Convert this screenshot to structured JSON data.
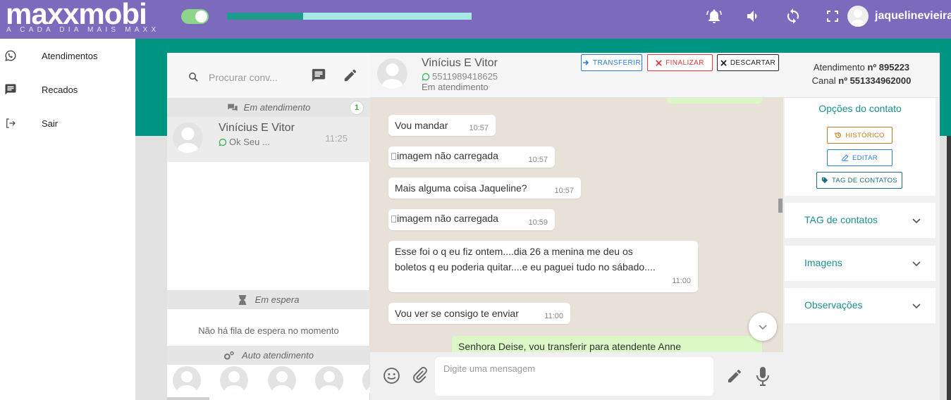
{
  "brand": {
    "name": "maxxmobi",
    "tagline": "A CADA DIA MAIS MAXX"
  },
  "topbar": {
    "progress_fraction": 0.31,
    "username": "jaquelinevieira",
    "icons": [
      "bell-icon",
      "volume-icon",
      "sync-icon",
      "fullscreen-icon"
    ]
  },
  "sidebar": {
    "items": [
      {
        "label": "Atendimentos",
        "icon": "whatsapp-icon"
      },
      {
        "label": "Recados",
        "icon": "message-icon"
      },
      {
        "label": "Sair",
        "icon": "logout-icon"
      }
    ]
  },
  "left": {
    "search_placeholder": "Procurar conv...",
    "section_active": "Em atendimento",
    "active_count": "1",
    "contact": {
      "name": "Vinícius E Vitor",
      "preview": "Ok  Seu ...",
      "time": "11:25"
    },
    "section_waiting": "Em espera",
    "waiting_empty": "Não há fila de espera no momento",
    "section_auto": "Auto atendimento"
  },
  "chat": {
    "name": "Vinícius E Vitor",
    "phone": "5511989418625",
    "status": "Em atendimento",
    "buttons": {
      "transfer": "TRANSFERIR",
      "finish": "FINALIZAR",
      "discard": "DESCARTAR"
    },
    "messages": [
      {
        "text": "Vou mandar",
        "time": "10:57"
      },
      {
        "text": "imagem não carregada",
        "time": "10:57",
        "image": true
      },
      {
        "text": "Mais alguma coisa Jaqueline?",
        "time": "10:57"
      },
      {
        "text": "imagem não carregada",
        "time": "10:59",
        "image": true
      },
      {
        "text": "Esse foi o q eu fiz ontem....dia 26 a menina me deu os boletos q eu poderia quitar....e eu paguei tudo  no sábado....",
        "time": "11:00"
      },
      {
        "text": "Vou ver se consigo te enviar",
        "time": "11:00"
      },
      {
        "text": "Senhora Deise, vou transferir para atendente Anne",
        "time": ""
      }
    ],
    "composer_placeholder": "Digite uma mensagem"
  },
  "right": {
    "atendimento_label": "Atendimento",
    "atendimento_no": "nº 895223",
    "canal_label": "Canal",
    "canal_no": "nº 551334962000",
    "options_title": "Opções do contato",
    "btn_history": "HISTÓRICO",
    "btn_edit": "EDITAR",
    "btn_tags": "TAG DE CONTATOS",
    "accordions": [
      "TAG de contatos",
      "Imagens",
      "Observações"
    ]
  },
  "colors": {
    "topbar": "#7c6bbd",
    "teal": "#009582",
    "accent_text": "#1c8f8f",
    "finish_red": "#e03c3c",
    "transfer_blue": "#2a7dd2"
  }
}
